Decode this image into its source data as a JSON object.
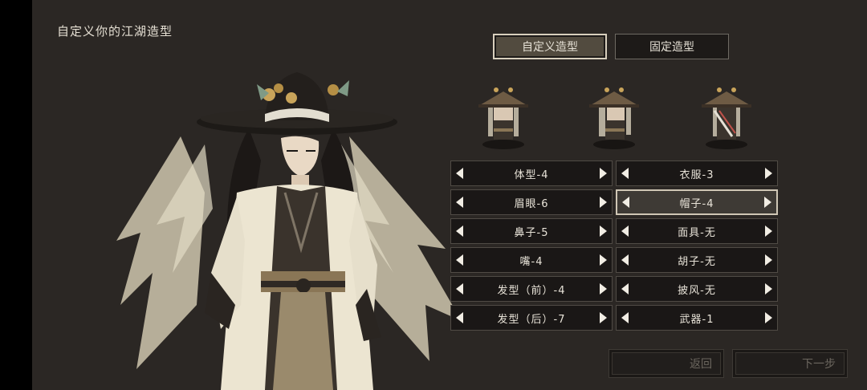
{
  "header": {
    "title": "自定义你的江湖造型"
  },
  "tabs": [
    {
      "label": "自定义造型",
      "active": true
    },
    {
      "label": "固定造型",
      "active": false
    }
  ],
  "sprites": [
    "character-sprite-front",
    "character-sprite-side",
    "character-sprite-back"
  ],
  "options_left": [
    {
      "label": "体型-4"
    },
    {
      "label": "眉眼-6"
    },
    {
      "label": "鼻子-5"
    },
    {
      "label": "嘴-4"
    },
    {
      "label": "发型（前）-4"
    },
    {
      "label": "发型（后）-7"
    }
  ],
  "options_right": [
    {
      "label": "衣服-3"
    },
    {
      "label": "帽子-4",
      "selected": true
    },
    {
      "label": "面具-无"
    },
    {
      "label": "胡子-无"
    },
    {
      "label": "披风-无"
    },
    {
      "label": "武器-1"
    }
  ],
  "footer": {
    "back_label": "返回",
    "next_label": "下一步"
  },
  "colors": {
    "background": "#2b2724",
    "panel": "#1a1716",
    "accent": "#cfc6b5",
    "text": "#e8e3d8"
  }
}
